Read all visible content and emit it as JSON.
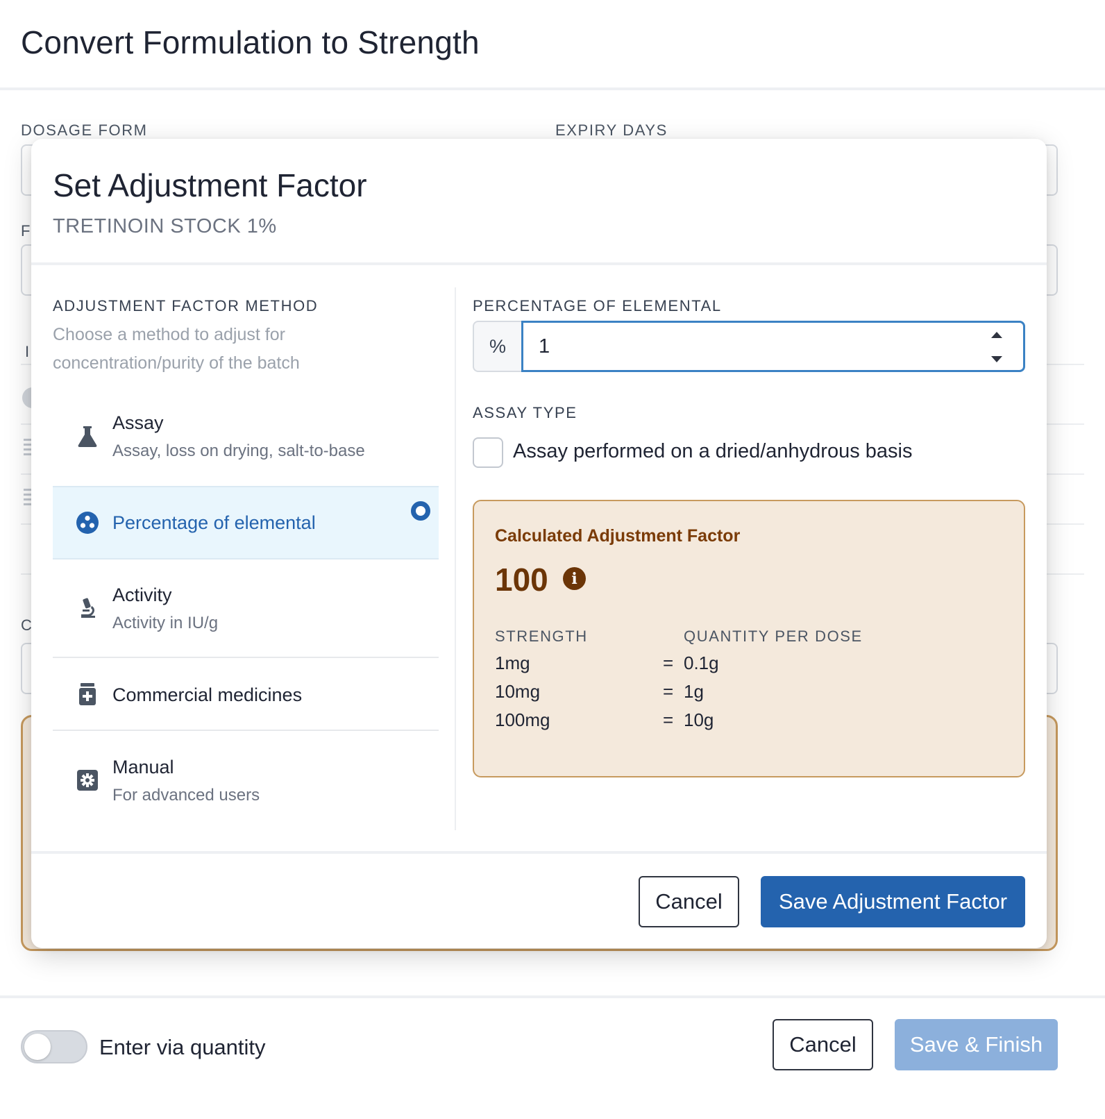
{
  "page": {
    "title": "Convert Formulation to Strength",
    "fields": {
      "dosage_form_label": "DOSAGE FORM",
      "expiry_days_label": "EXPIRY DAYS",
      "obscured_label_1": "F",
      "obscured_label_2": "I",
      "obscured_label_3": "C"
    },
    "footer": {
      "toggle_label": "Enter via quantity",
      "cancel_label": "Cancel",
      "save_finish_label": "Save & Finish"
    }
  },
  "modal": {
    "title": "Set Adjustment Factor",
    "subtitle": "TRETINOIN STOCK 1%",
    "method_section": {
      "label": "ADJUSTMENT FACTOR METHOD",
      "help": "Choose a method to adjust for concentration/purity of the batch",
      "methods": [
        {
          "title": "Assay",
          "description": "Assay, loss on drying, salt-to-base",
          "icon": "flask-icon",
          "selected": false
        },
        {
          "title": "Percentage of elemental",
          "description": "",
          "icon": "atom-icon",
          "selected": true
        },
        {
          "title": "Activity",
          "description": "Activity in IU/g",
          "icon": "microscope-icon",
          "selected": false
        },
        {
          "title": "Commercial medicines",
          "description": "",
          "icon": "medicine-box-icon",
          "selected": false
        },
        {
          "title": "Manual",
          "description": "For advanced users",
          "icon": "gear-icon",
          "selected": false
        }
      ]
    },
    "percentage": {
      "label": "PERCENTAGE OF ELEMENTAL",
      "addon": "%",
      "value": "1"
    },
    "assay_type": {
      "label": "ASSAY TYPE",
      "checkbox_label": "Assay performed on a dried/anhydrous basis",
      "checked": false
    },
    "result": {
      "title": "Calculated Adjustment Factor",
      "value": "100",
      "columns": [
        "STRENGTH",
        "QUANTITY PER DOSE"
      ],
      "rows": [
        {
          "strength": "1mg",
          "equals": "=",
          "quantity": "0.1g"
        },
        {
          "strength": "10mg",
          "equals": "=",
          "quantity": "1g"
        },
        {
          "strength": "100mg",
          "equals": "=",
          "quantity": "10g"
        }
      ]
    },
    "buttons": {
      "cancel": "Cancel",
      "save": "Save Adjustment Factor"
    }
  },
  "colors": {
    "primary": "#2463ae",
    "primary_faded": "#8cb0dc",
    "selected_bg": "#e9f6fd",
    "result_bg": "#f4e9dc",
    "result_border": "#c79a5e",
    "result_text": "#6b3507"
  }
}
